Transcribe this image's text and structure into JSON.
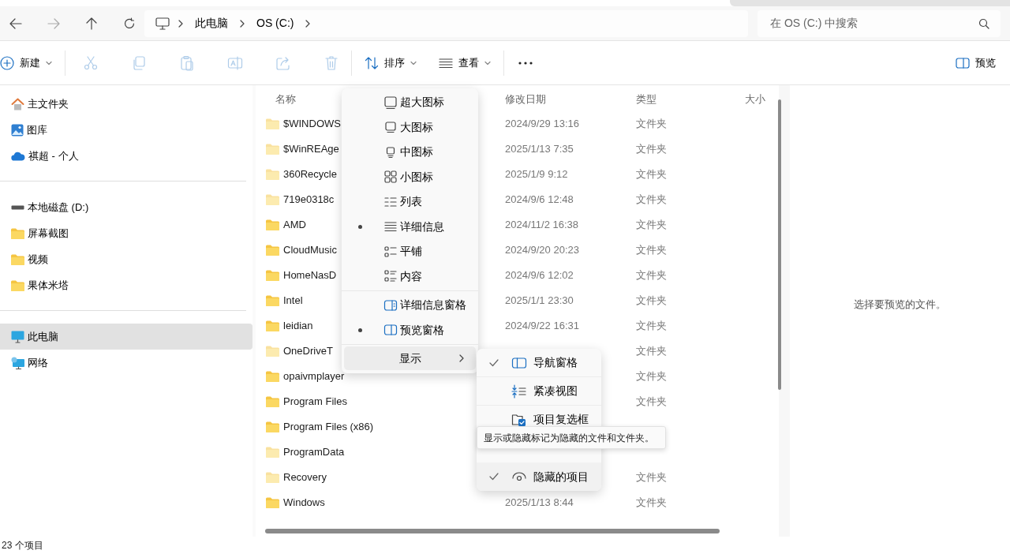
{
  "address_bar": {
    "breadcrumbs": [
      "此电脑",
      "OS (C:)"
    ]
  },
  "search": {
    "placeholder": "在 OS (C:) 中搜索"
  },
  "toolbar": {
    "new_label": "新建",
    "actions": [
      {
        "kind": "cut",
        "disabled": true
      },
      {
        "kind": "copy",
        "disabled": true
      },
      {
        "kind": "paste",
        "disabled": true
      },
      {
        "kind": "rename",
        "disabled": true
      },
      {
        "kind": "share",
        "disabled": true
      },
      {
        "kind": "delete",
        "disabled": true
      }
    ],
    "sort_label": "排序",
    "view_label": "查看",
    "preview_label": "预览"
  },
  "sidebar": {
    "groups": [
      [
        {
          "label": "主文件夹",
          "kind": "home",
          "selected": false
        },
        {
          "label": "图库",
          "kind": "gallery",
          "selected": false
        },
        {
          "label": "祺超 - 个人",
          "kind": "cloud",
          "selected": false
        }
      ],
      [
        {
          "label": "本地磁盘 (D:)",
          "kind": "drive",
          "selected": false
        },
        {
          "label": "屏幕截图",
          "kind": "folder",
          "selected": false
        },
        {
          "label": "视频",
          "kind": "folder",
          "selected": false
        },
        {
          "label": "果体米塔",
          "kind": "folder",
          "selected": false
        }
      ],
      [
        {
          "label": "此电脑",
          "kind": "pc",
          "selected": true
        },
        {
          "label": "网络",
          "kind": "network",
          "selected": false
        }
      ]
    ]
  },
  "file_list": {
    "columns": [
      "名称",
      "修改日期",
      "类型",
      "大小"
    ],
    "rows": [
      {
        "name": "$WINDOWS",
        "date": "2024/9/29 13:16",
        "type": "文件夹",
        "hidden": true
      },
      {
        "name": "$WinREAge",
        "date": "2025/1/13 7:35",
        "type": "文件夹",
        "hidden": true
      },
      {
        "name": "360Recycle",
        "date": "2025/1/9 9:12",
        "type": "文件夹",
        "hidden": true
      },
      {
        "name": "719e0318c",
        "date": "2024/9/6 12:48",
        "type": "文件夹",
        "hidden": true
      },
      {
        "name": "AMD",
        "date": "2024/11/2 16:38",
        "type": "文件夹",
        "hidden": false
      },
      {
        "name": "CloudMusic",
        "date": "2024/9/20 20:23",
        "type": "文件夹",
        "hidden": false
      },
      {
        "name": "HomeNasD",
        "date": "2024/9/6 12:02",
        "type": "文件夹",
        "hidden": false
      },
      {
        "name": "Intel",
        "date": "2025/1/1 23:30",
        "type": "文件夹",
        "hidden": false
      },
      {
        "name": "leidian",
        "date": "2024/9/22 16:31",
        "type": "文件夹",
        "hidden": false
      },
      {
        "name": "OneDriveT",
        "type": "文件夹",
        "hidden": true
      },
      {
        "name": "opaivmplayer",
        "type": "文件夹",
        "hidden": false
      },
      {
        "name": "Program Files",
        "type": "文件夹",
        "hidden": false
      },
      {
        "name": "Program Files (x86)",
        "hidden": false
      },
      {
        "name": "ProgramData",
        "hidden": true
      },
      {
        "name": "Recovery",
        "type": "文件夹",
        "hidden": true
      },
      {
        "name": "Windows",
        "date": "2025/1/13 8:44",
        "type": "文件夹",
        "hidden": false
      }
    ]
  },
  "preview_pane": {
    "message": "选择要预览的文件。"
  },
  "status_bar": {
    "item_count": "23 个项目"
  },
  "view_menu": {
    "groups": [
      [
        {
          "label": "超大图标",
          "kind": "xl",
          "selected": false
        },
        {
          "label": "大图标",
          "kind": "lg",
          "selected": false
        },
        {
          "label": "中图标",
          "kind": "md",
          "selected": false
        },
        {
          "label": "小图标",
          "kind": "sm",
          "selected": false
        },
        {
          "label": "列表",
          "kind": "list",
          "selected": false
        },
        {
          "label": "详细信息",
          "kind": "details",
          "selected": true
        },
        {
          "label": "平铺",
          "kind": "tiles",
          "selected": false
        },
        {
          "label": "内容",
          "kind": "content",
          "selected": false
        }
      ],
      [
        {
          "label": "详细信息窗格",
          "kind": "detailspane",
          "selected": false
        },
        {
          "label": "预览窗格",
          "kind": "previewpane",
          "selected": true
        }
      ]
    ],
    "show_item": {
      "label": "显示",
      "expanded": true
    }
  },
  "show_submenu": {
    "items": [
      {
        "label": "导航窗格",
        "kind": "navpane",
        "checked": true
      },
      {
        "label": "紧凑视图",
        "kind": "compact",
        "checked": false
      },
      {
        "label": "项目复选框",
        "kind": "checkbox",
        "checked": false
      },
      {
        "label": "隐藏的项目",
        "kind": "hidden",
        "checked": true
      }
    ]
  },
  "tooltip": {
    "text": "显示或隐藏标记为隐藏的文件和文件夹。"
  }
}
